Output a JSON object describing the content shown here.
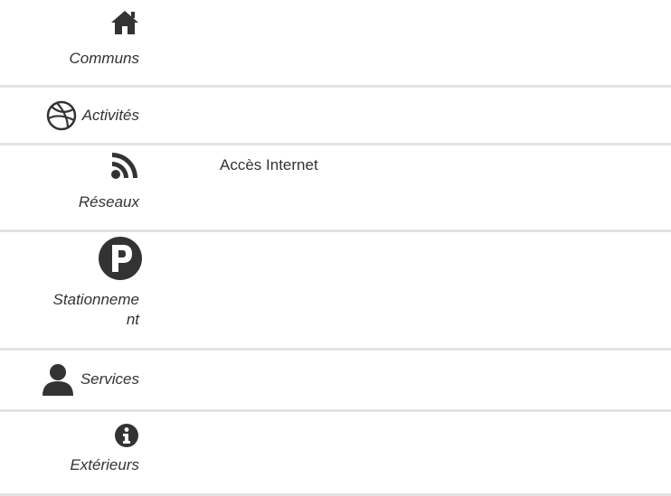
{
  "categories": [
    {
      "label": "Communs",
      "icon": "home-icon",
      "values": []
    },
    {
      "label": "Activités",
      "icon": "dribbble-icon",
      "values": []
    },
    {
      "label": "Réseaux",
      "icon": "rss-icon",
      "values": [
        "Accès Internet"
      ]
    },
    {
      "label": "Stationneme nt",
      "icon": "parking-icon",
      "values": []
    },
    {
      "label": "Services",
      "icon": "user-icon",
      "values": []
    },
    {
      "label": "Extérieurs",
      "icon": "info-icon",
      "values": []
    }
  ]
}
